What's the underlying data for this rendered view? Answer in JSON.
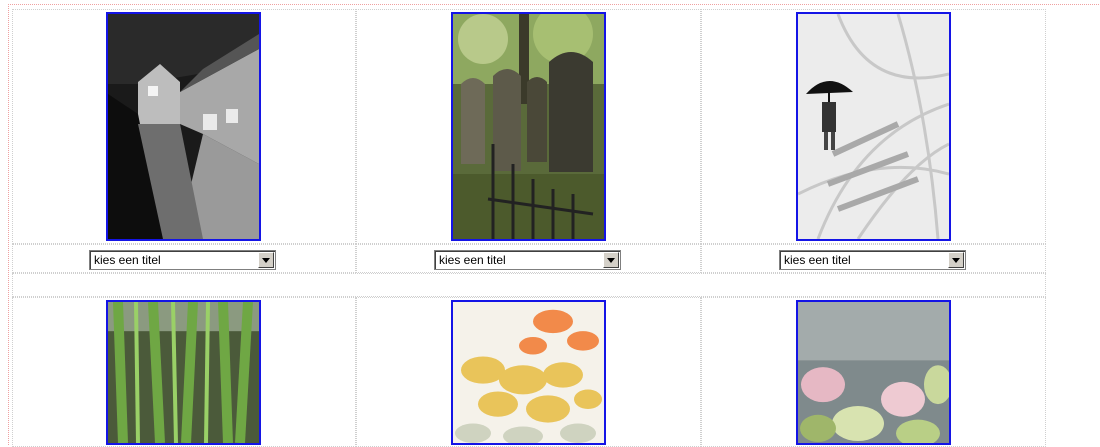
{
  "gallery": {
    "photos": [
      {
        "icon": "alley-photo"
      },
      {
        "icon": "graveyard-photo"
      },
      {
        "icon": "umbrella-walker-photo"
      },
      {
        "icon": "green-stems-photo"
      },
      {
        "icon": "rose-petals-photo"
      },
      {
        "icon": "pink-flowers-photo"
      }
    ],
    "title_selects": [
      {
        "selected": "kies een titel"
      },
      {
        "selected": "kies een titel"
      },
      {
        "selected": "kies een titel"
      }
    ]
  },
  "colors": {
    "photo_border": "#1414e6",
    "cell_border": "#cfcfcf",
    "frame_border": "#f0a0a0"
  }
}
